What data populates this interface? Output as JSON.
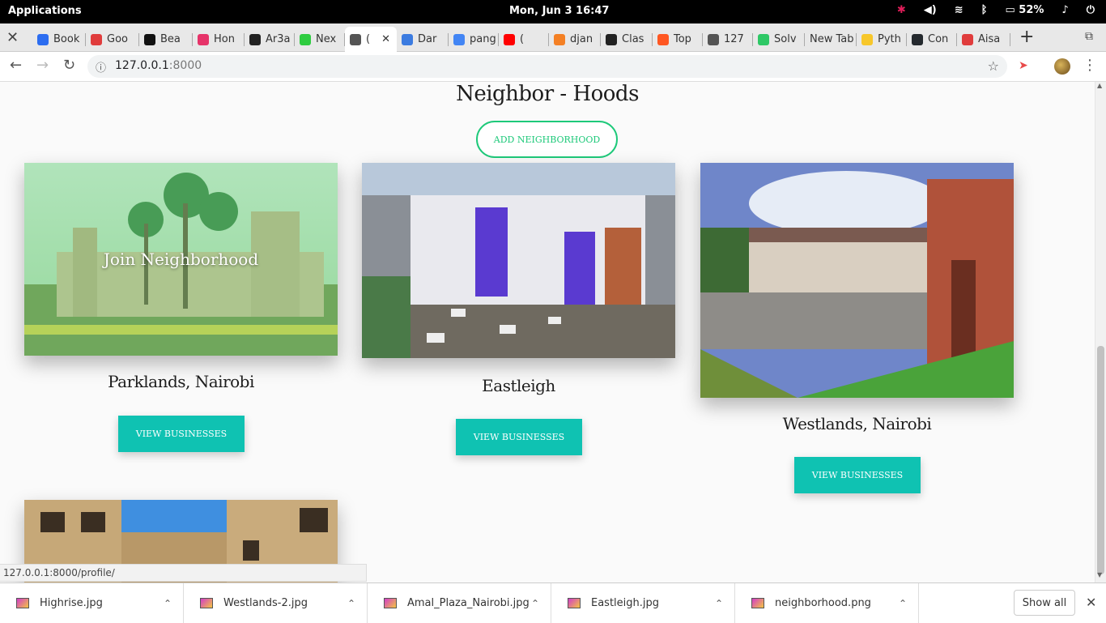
{
  "os": {
    "apps_label": "Applications",
    "clock": "Mon, Jun  3   16:47",
    "battery": "52%",
    "icons": [
      "slack-icon",
      "volume-icon",
      "wifi-icon",
      "bluetooth-icon",
      "battery-icon",
      "bell-icon",
      "power-icon"
    ]
  },
  "tabs": [
    {
      "label": "Book",
      "fav": "#2c6df0"
    },
    {
      "label": "Goo",
      "fav": "#e03c3c"
    },
    {
      "label": "Bea",
      "fav": "#111111"
    },
    {
      "label": "Hon",
      "fav": "#e63369"
    },
    {
      "label": "Ar3a",
      "fav": "#222222"
    },
    {
      "label": "Nex",
      "fav": "#2ecc40"
    },
    {
      "label": "(",
      "fav": "#555555"
    },
    {
      "label": "Dar",
      "fav": "#3b7be0"
    },
    {
      "label": "pang",
      "fav": "#4285f4"
    },
    {
      "label": "(",
      "fav": "#ff0000"
    },
    {
      "label": "djan",
      "fav": "#f48024"
    },
    {
      "label": "Clas",
      "fav": "#222222"
    },
    {
      "label": "Top",
      "fav": "#ff5722"
    },
    {
      "label": "127",
      "fav": "#555555"
    },
    {
      "label": "Solv",
      "fav": "#2ec866"
    },
    {
      "label": "New Tab",
      "fav": ""
    },
    {
      "label": "Pyth",
      "fav": "#f7c72a"
    },
    {
      "label": "Con",
      "fav": "#24292e"
    },
    {
      "label": "Aisa",
      "fav": "#e03c3c"
    }
  ],
  "address": {
    "host": "127.0.0.1",
    "port": ":8000"
  },
  "page": {
    "title": "Neighbor - Hoods",
    "add_button": "ADD NEIGHBORHOOD",
    "overlay_text": "Join Neighborhood",
    "cards": [
      {
        "name": "Parklands, Nairobi",
        "button": "VIEW BUSINESSES"
      },
      {
        "name": "Eastleigh",
        "button": "VIEW BUSINESSES"
      },
      {
        "name": "Westlands, Nairobi",
        "button": "VIEW BUSINESSES"
      }
    ]
  },
  "status_url": "127.0.0.1:8000/profile/",
  "downloads": {
    "items": [
      "Highrise.jpg",
      "Westlands-2.jpg",
      "Amal_Plaza_Nairobi.jpg",
      "Eastleigh.jpg",
      "neighborhood.png"
    ],
    "show_all": "Show all"
  }
}
